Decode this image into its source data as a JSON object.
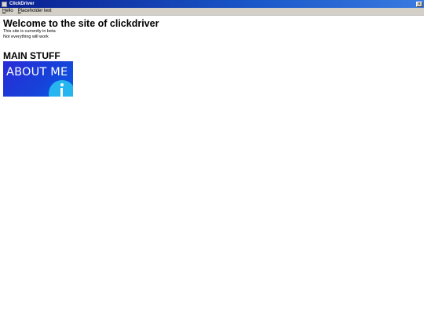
{
  "window": {
    "title": "ClickDriver",
    "close_glyph": "x"
  },
  "menu": {
    "items": [
      {
        "accel": "H",
        "rest": "ello"
      },
      {
        "accel": "P",
        "rest": "laceholder text"
      }
    ]
  },
  "page": {
    "heading": "Welcome to the site of clickdriver",
    "lines": [
      "This site is currently in beta",
      "Not everything will work"
    ],
    "section_title": "MAIN STUFF",
    "about_tile": {
      "label": "ABOUT ME",
      "icon": "info-icon"
    }
  },
  "colors": {
    "titlebar": "#0a1f8f",
    "tile_bg": "#1741d8",
    "info_circle": "#27b5f0"
  }
}
